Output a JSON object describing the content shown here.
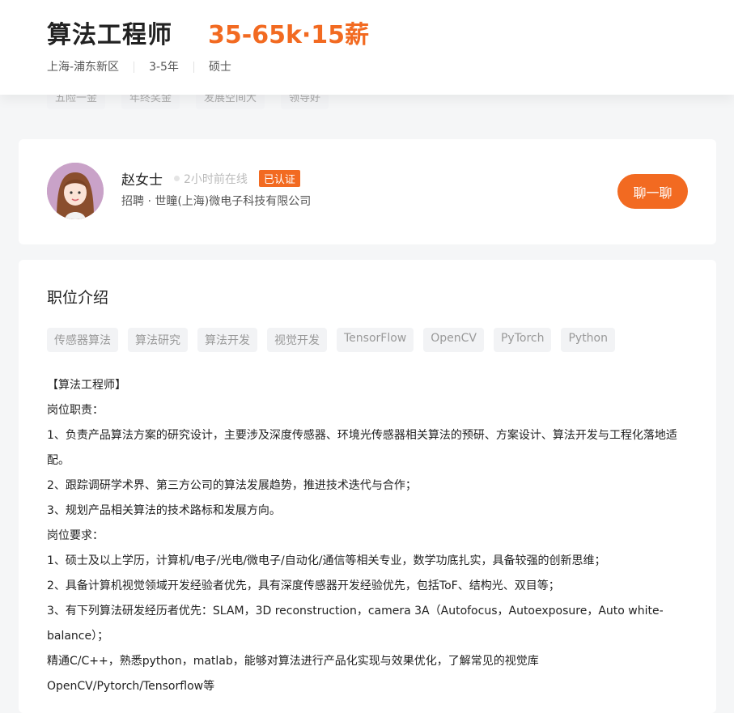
{
  "job": {
    "title": "算法工程师",
    "salary": "35-65k·15薪",
    "location": "上海-浦东新区",
    "experience": "3-5年",
    "education": "硕士"
  },
  "benefits": [
    "五险一金",
    "年终奖金",
    "发展空间大",
    "领导好"
  ],
  "recruiter": {
    "name": "赵女士",
    "online_status": "2小时前在线",
    "verified_badge": "已认证",
    "company_line": "招聘 · 世瞳(上海)微电子科技有限公司",
    "chat_button": "聊一聊"
  },
  "description": {
    "section_title": "职位介绍",
    "skills": [
      "传感器算法",
      "算法研究",
      "算法开发",
      "视觉开发",
      "TensorFlow",
      "OpenCV",
      "PyTorch",
      "Python"
    ],
    "lines": [
      "【算法工程师】",
      "岗位职责：",
      "1、负责产品算法方案的研究设计，主要涉及深度传感器、环境光传感器相关算法的预研、方案设计、算法开发与工程化落地适配。",
      "2、跟踪调研学术界、第三方公司的算法发展趋势，推进技术迭代与合作；",
      "3、规划产品相关算法的技术路标和发展方向。",
      "岗位要求：",
      "1、硕士及以上学历，计算机/电子/光电/微电子/自动化/通信等相关专业，数学功底扎实，具备较强的创新思维；",
      "2、具备计算机视觉领域开发经验者优先，具有深度传感器开发经验优先，包括ToF、结构光、双目等；",
      "3、有下列算法研发经历者优先：SLAM，3D reconstruction，camera 3A（Autofocus，Autoexposure，Auto white-balance）；",
      "精通C/C++，熟悉python，matlab，能够对算法进行产品化实现与效果优化，了解常见的视觉库OpenCV/Pytorch/Tensorflow等"
    ]
  },
  "colors": {
    "accent": "#f26a21",
    "tag_bg": "#f2f3f5",
    "page_bg": "#f5f6f7"
  }
}
